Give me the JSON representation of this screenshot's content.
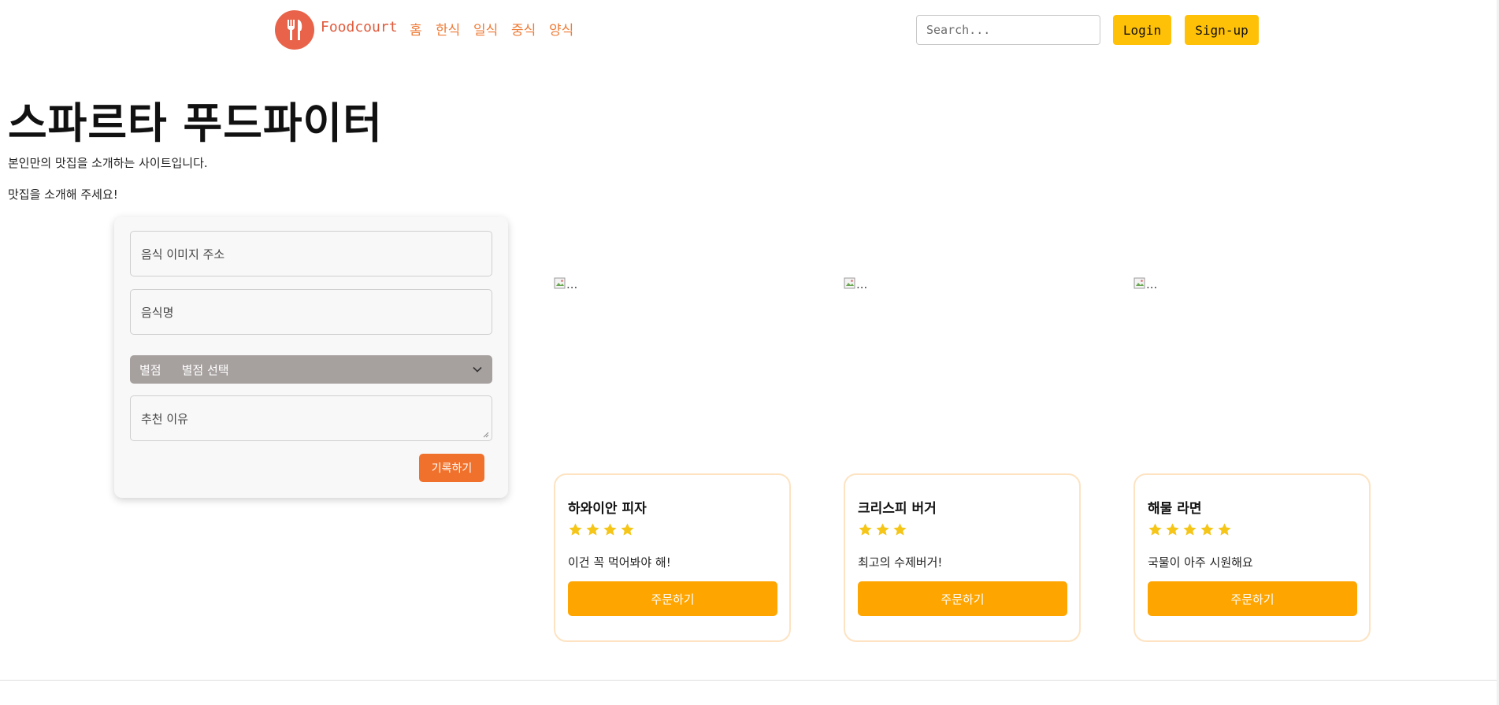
{
  "navbar": {
    "brand_name": "Foodcourt",
    "links": [
      "홈",
      "한식",
      "일식",
      "중식",
      "양식"
    ],
    "search_placeholder": "Search...",
    "login_label": "Login",
    "signup_label": "Sign-up",
    "icons": {
      "logo": "fork-knife-icon"
    }
  },
  "hero": {
    "title": "스파르타 푸드파이터",
    "subtitle": "본인만의 맛집을 소개하는 사이트입니다.",
    "prompt": "맛집을 소개해 주세요!"
  },
  "form": {
    "image_url_placeholder": "음식 이미지 주소",
    "food_name_placeholder": "음식명",
    "rating_label": "별점",
    "rating_value": "별점 선택",
    "reason_placeholder": "추천 이유",
    "submit_label": "기록하기"
  },
  "cards": [
    {
      "image_alt": "...",
      "title": "하와이안 피자",
      "rating": 4,
      "description": "이건 꼭 먹어봐야 해!",
      "button_label": "주문하기"
    },
    {
      "image_alt": "...",
      "title": "크리스피 버거",
      "rating": 3,
      "description": "최고의 수제버거!",
      "button_label": "주문하기"
    },
    {
      "image_alt": "...",
      "title": "해물 라면",
      "rating": 5,
      "description": "국물이 아주 시원해요",
      "button_label": "주문하기"
    }
  ],
  "colors": {
    "brand": "#e05a3b",
    "nav_link": "#ef7a35",
    "auth_button": "#ffc107",
    "submit_button": "#f0712b",
    "order_button": "#ffa500",
    "star": "#f5c518",
    "card_border": "#fde3c2",
    "select_bg": "#a6a09f"
  }
}
